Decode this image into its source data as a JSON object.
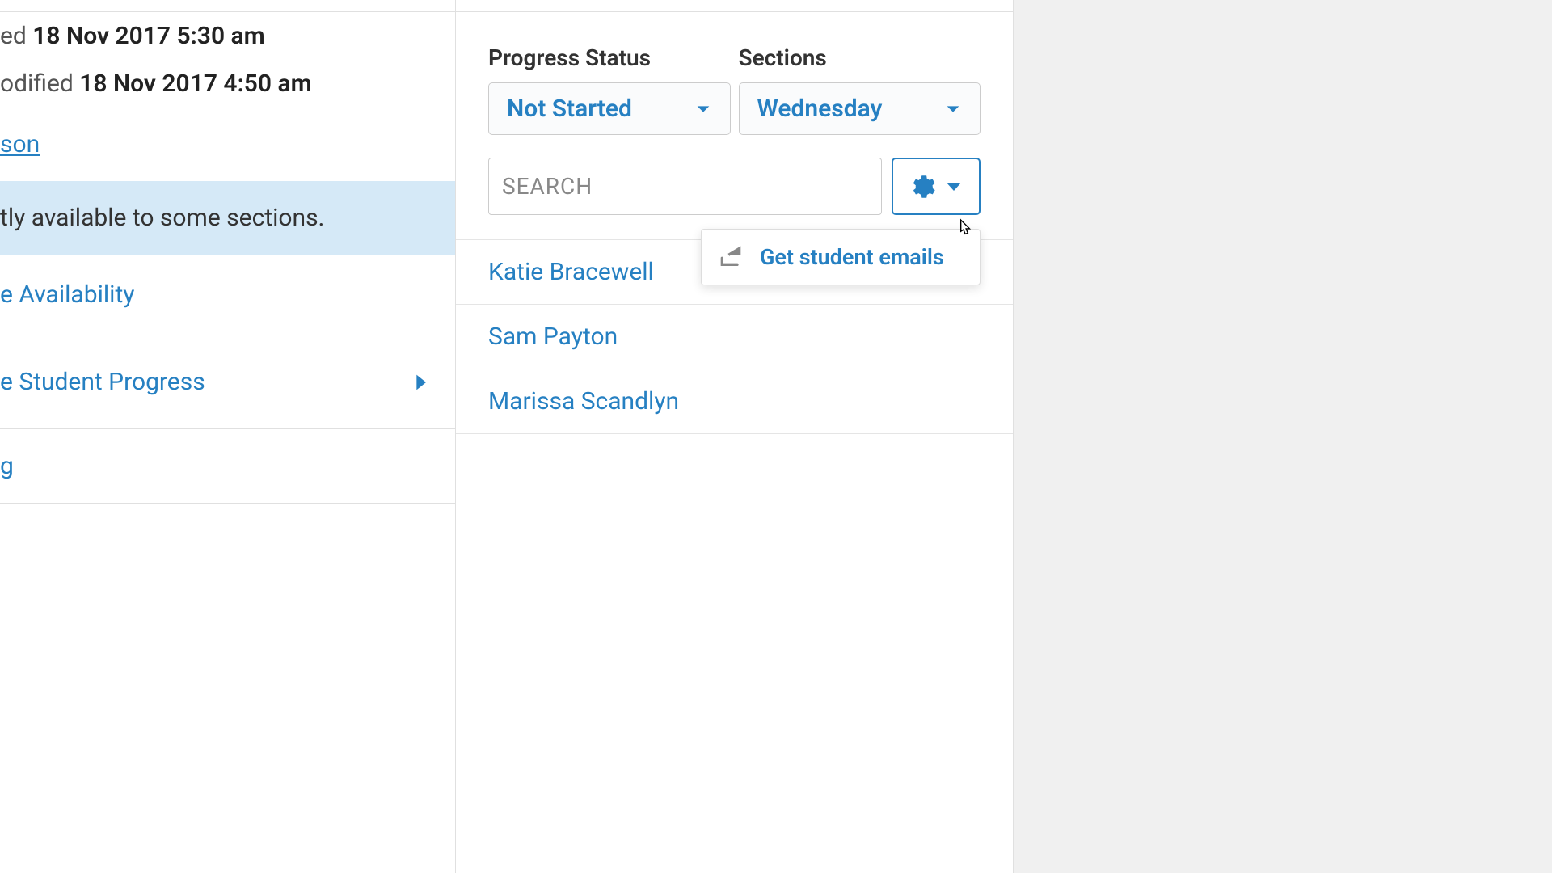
{
  "left": {
    "created_prefix": "ed ",
    "created_date": "18 Nov 2017  5:30 am",
    "modified_prefix": "odified ",
    "modified_date": "18 Nov 2017  4:50 am",
    "lesson_link": "son",
    "banner_text": "tly available to some sections.",
    "availability_link": "e Availability",
    "progress_link": "e Student Progress",
    "truncated_link": "g"
  },
  "right": {
    "filters": {
      "progress_label": "Progress Status",
      "progress_value": "Not Started",
      "sections_label": "Sections",
      "sections_value": "Wednesday"
    },
    "search_placeholder": "SEARCH",
    "students": [
      "Katie Bracewell",
      "Sam Payton",
      "Marissa Scandlyn"
    ],
    "menu": {
      "get_emails": "Get student emails"
    }
  }
}
